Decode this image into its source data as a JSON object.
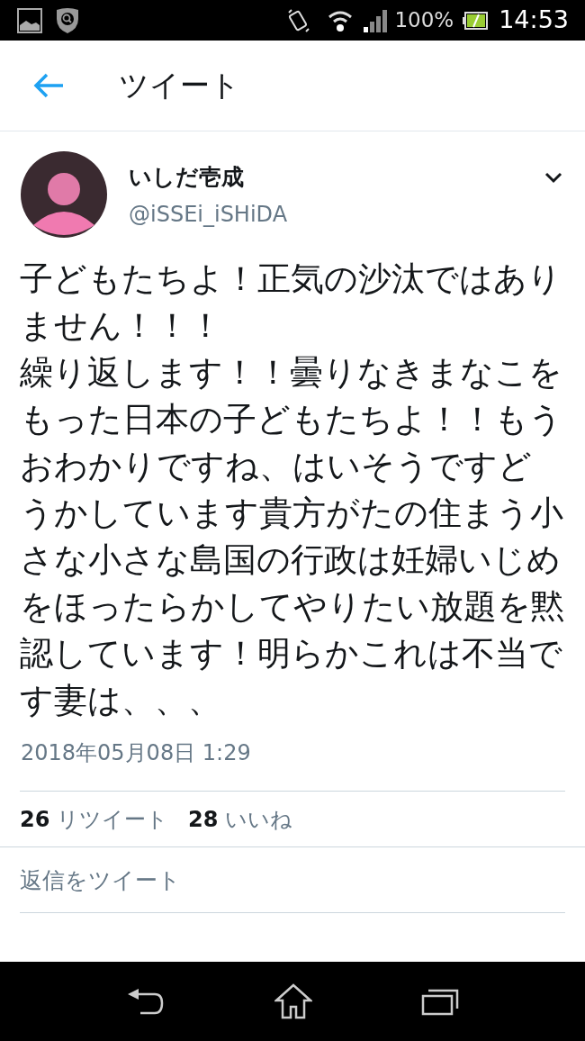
{
  "status_bar": {
    "battery": "100%",
    "time": "14:53"
  },
  "header": {
    "title": "ツイート"
  },
  "tweet": {
    "name": "いしだ壱成",
    "handle": "@iSSEi_iSHiDA",
    "paragraphs": [
      "子どもたちよ！正気の沙汰ではありません！！！",
      "繰り返します！！曇りなきまなこをもった日本の子どもたちよ！！もうおわかりですね、はいそうですどうかしています貴方がたの住まう小さな小さな島国の行政は妊婦いじめをほったらかしてやりたい放題を黙認しています！明らかこれは不当です妻は、、、"
    ],
    "timestamp": "2018年05月08日 1:29",
    "stats": [
      {
        "count": "26",
        "label": "リツイート"
      },
      {
        "count": "28",
        "label": "いいね"
      }
    ]
  },
  "reply": {
    "placeholder": "返信をツイート"
  }
}
